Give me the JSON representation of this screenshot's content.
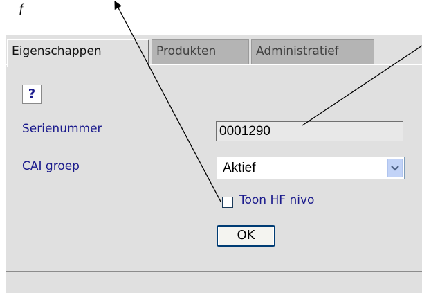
{
  "doc_fragment": "f",
  "tabs": [
    {
      "label": "Eigenschappen",
      "active": true
    },
    {
      "label": "Produkten",
      "active": false
    },
    {
      "label": "Administratief",
      "active": false
    }
  ],
  "help_button": {
    "label": "?"
  },
  "fields": {
    "serial": {
      "label": "Serienummer",
      "value": "0001290"
    },
    "cai_group": {
      "label": "CAI groep",
      "selected": "Aktief"
    }
  },
  "checkbox": {
    "label": "Toon HF nivo",
    "checked": false
  },
  "ok_button": {
    "label": "OK"
  },
  "colors": {
    "panel_bg": "#e0e0e0",
    "label_text": "#1a1a8c",
    "inactive_tab": "#b4b4b4",
    "select_arrow_bg": "#c2d3f7"
  }
}
